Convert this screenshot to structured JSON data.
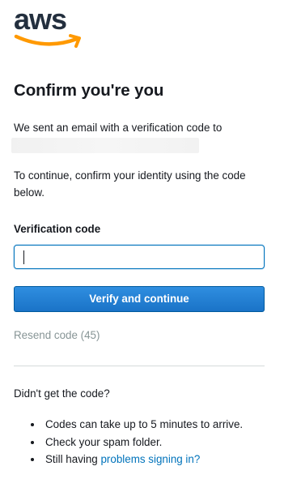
{
  "logo": {
    "text": "aws",
    "accent_color": "#FF9900",
    "text_color": "#232F3E"
  },
  "title": "Confirm you're you",
  "message": {
    "line1": "We sent an email with a verification code to",
    "line2": "To continue, confirm your identity using the code below."
  },
  "form": {
    "label": "Verification code",
    "value": "",
    "placeholder": ""
  },
  "verify_button": {
    "label": "Verify and continue",
    "color": "#1A73C7"
  },
  "resend": {
    "label": "Resend code (45)"
  },
  "help": {
    "heading": "Didn't get the code?",
    "items": [
      {
        "text": "Codes can take up to 5 minutes to arrive."
      },
      {
        "text": "Check your spam folder."
      },
      {
        "text_prefix": "Still having ",
        "link": "problems signing in?"
      }
    ]
  }
}
